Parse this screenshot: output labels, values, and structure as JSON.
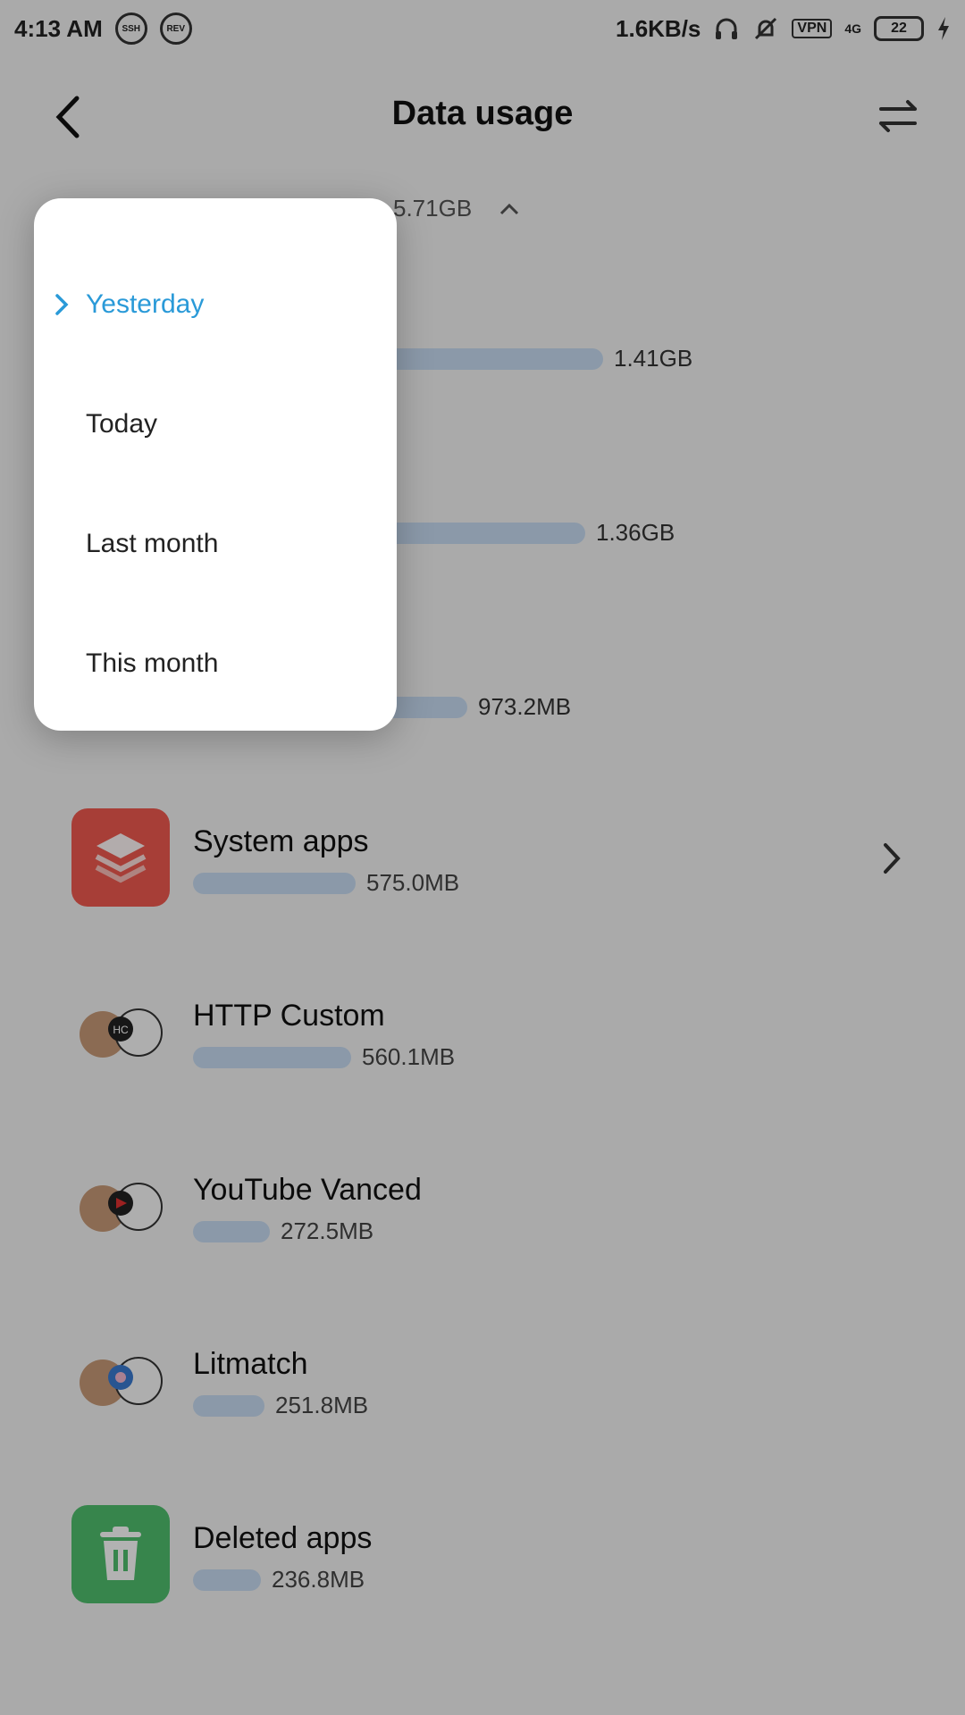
{
  "status_bar": {
    "time": "4:13 AM",
    "badges": [
      "SSH",
      "REV"
    ],
    "speed": "1.6KB/s",
    "vpn": "VPN",
    "network": "4G",
    "battery": "22"
  },
  "header": {
    "title": "Data usage",
    "back_icon": "chevron-left-icon",
    "filter_icon": "swap-arrows-icon"
  },
  "summary": {
    "total": "5.71GB"
  },
  "hidden_rows": [
    {
      "usage": "1.41GB",
      "fraction": 0.43
    },
    {
      "usage": "1.36GB",
      "fraction": 0.41
    },
    {
      "usage": "973.2MB",
      "fraction": 0.29
    }
  ],
  "apps": [
    {
      "name": "System apps",
      "usage": "575.0MB",
      "fraction": 0.175,
      "icon": "layers-icon",
      "color": "#ef5a4f",
      "has_chevron": true
    },
    {
      "name": "HTTP Custom",
      "usage": "560.1MB",
      "fraction": 0.17,
      "icon": "bear-panda-icon",
      "color": "#ffffff",
      "has_chevron": false
    },
    {
      "name": "YouTube Vanced",
      "usage": "272.5MB",
      "fraction": 0.083,
      "icon": "bear-panda-icon",
      "color": "#ffffff",
      "has_chevron": false
    },
    {
      "name": "Litmatch",
      "usage": "251.8MB",
      "fraction": 0.077,
      "icon": "bear-panda-icon",
      "color": "#ffffff",
      "has_chevron": false
    },
    {
      "name": "Deleted apps",
      "usage": "236.8MB",
      "fraction": 0.072,
      "icon": "trash-icon",
      "color": "#4fbf6e",
      "has_chevron": false
    }
  ],
  "dropdown": {
    "options": [
      "Yesterday",
      "Today",
      "Last month",
      "This month"
    ],
    "selected": "Yesterday",
    "accent_color": "#2a9ad8"
  }
}
